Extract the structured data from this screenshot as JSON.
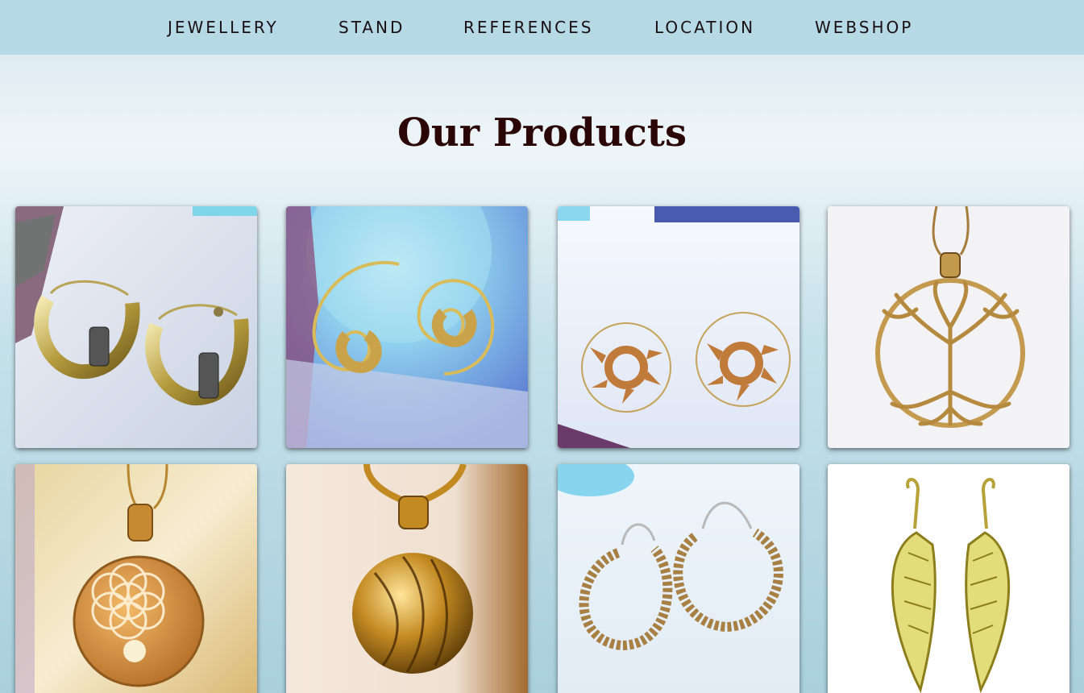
{
  "nav": {
    "items": [
      {
        "label": "JEWELLERY"
      },
      {
        "label": "STAND"
      },
      {
        "label": "REFERENCES"
      },
      {
        "label": "LOCATION"
      },
      {
        "label": "WEBSHOP"
      }
    ]
  },
  "main": {
    "title": "Our Products"
  },
  "products": [
    {
      "icon": "hoop-earrings-image"
    },
    {
      "icon": "spiral-earrings-image"
    },
    {
      "icon": "lotus-spiral-earrings-image"
    },
    {
      "icon": "tree-of-life-pendant-image"
    },
    {
      "icon": "flower-of-life-pendant-image"
    },
    {
      "icon": "cage-ball-pendant-image"
    },
    {
      "icon": "mandala-hoop-earrings-image"
    },
    {
      "icon": "angel-wing-earrings-image"
    }
  ],
  "colors": {
    "nav_bg": "#b5d9e5",
    "title": "#2a0606",
    "nav_text": "#1a0f12",
    "gold": "#c9a24a"
  }
}
